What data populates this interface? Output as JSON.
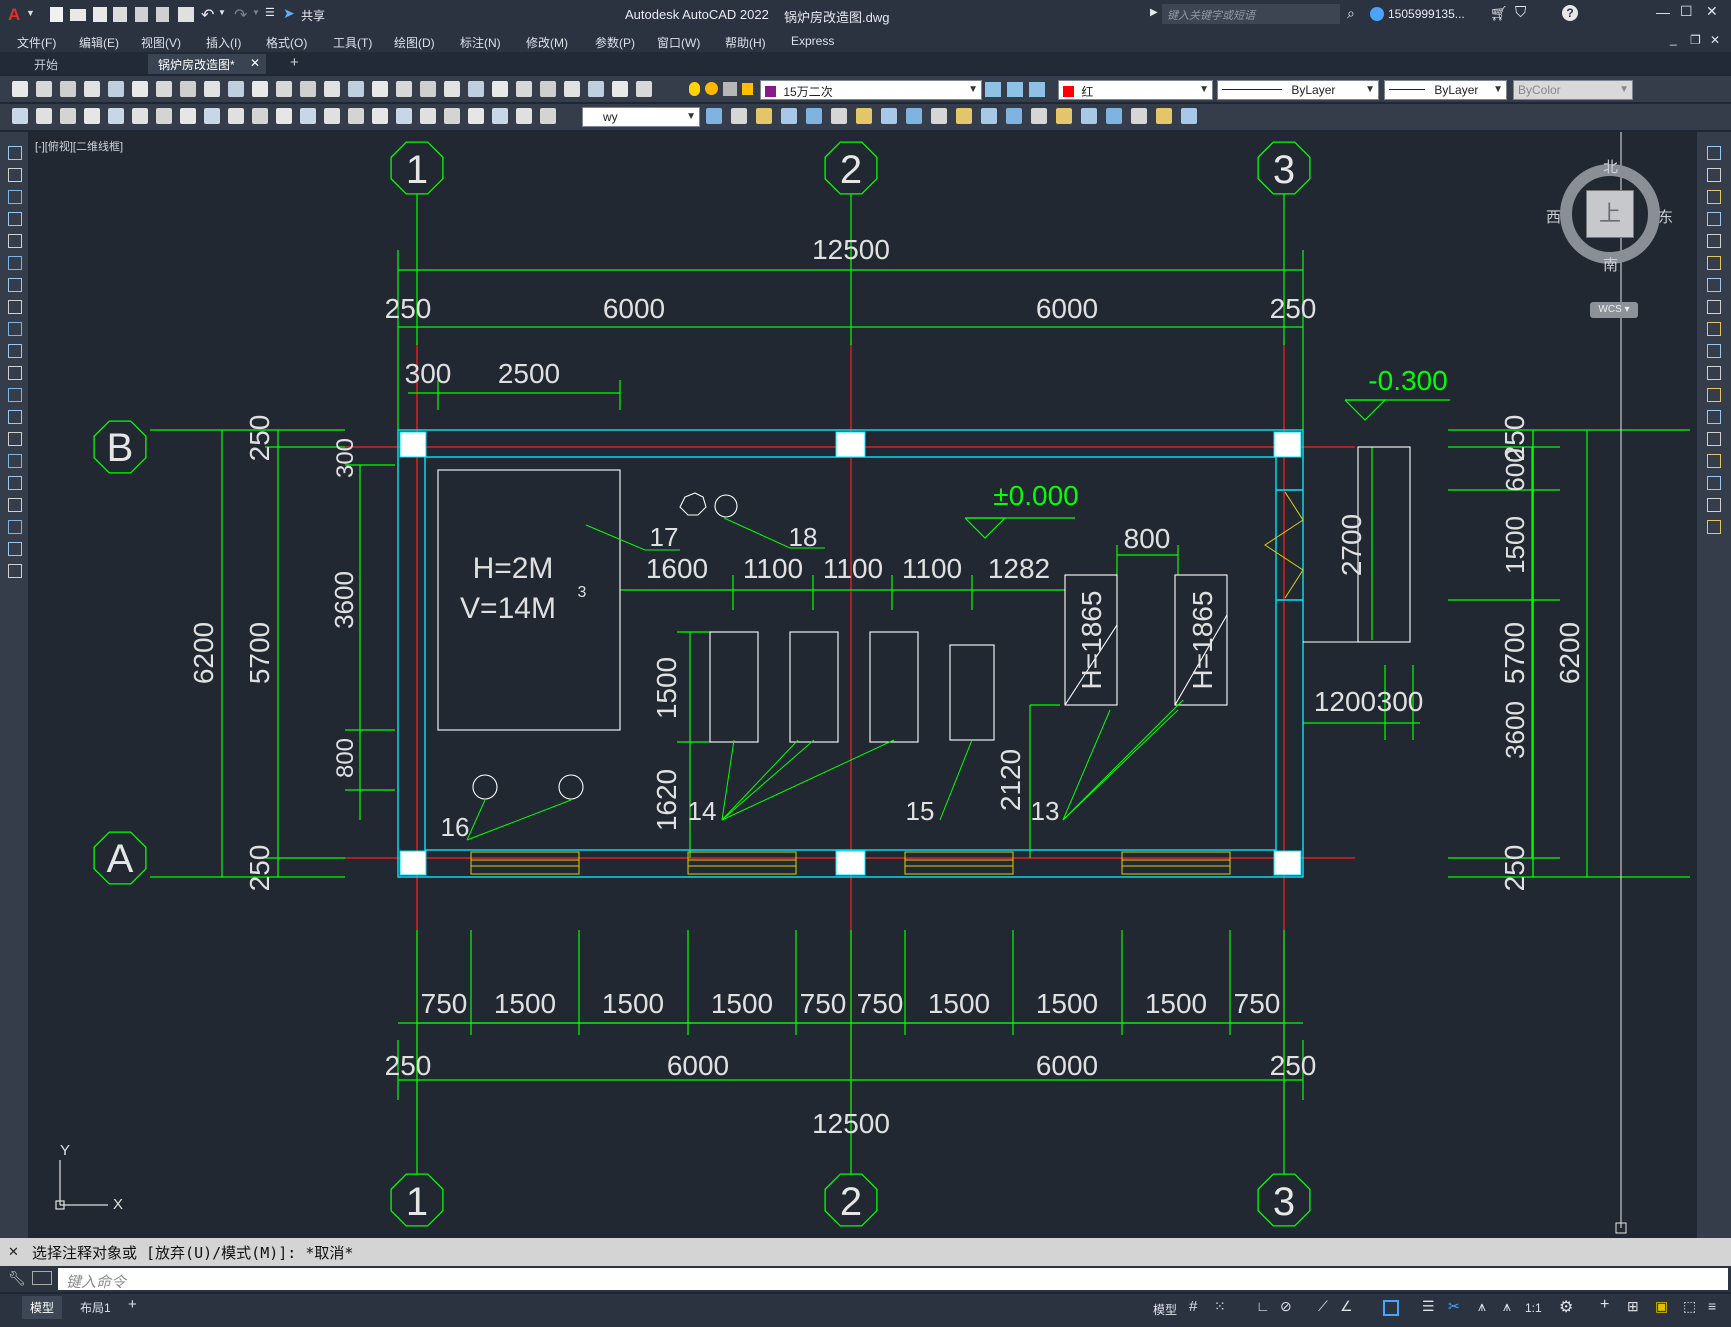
{
  "titlebar": {
    "app_title": "Autodesk AutoCAD 2022",
    "file_name": "锅炉房改造图.dwg",
    "share_label": "共享",
    "search_placeholder": "键入关键字或短语",
    "user_name": "1505999135...",
    "window_controls": [
      "minimize-icon",
      "maximize-icon",
      "close-icon"
    ]
  },
  "menu": {
    "items": [
      "文件(F)",
      "编辑(E)",
      "视图(V)",
      "插入(I)",
      "格式(O)",
      "工具(T)",
      "绘图(D)",
      "标注(N)",
      "修改(M)",
      "参数(P)",
      "窗口(W)",
      "帮助(H)",
      "Express"
    ]
  },
  "tabs": {
    "items": [
      {
        "label": "开始",
        "active": false
      },
      {
        "label": "锅炉房改造图*",
        "active": true
      }
    ],
    "new_tab": "+"
  },
  "toolbar": {
    "layer_name": "15万二次",
    "layer_color": "#8a1a8a",
    "color_name": "红",
    "color_swatch": "#ff0000",
    "linetype": "ByLayer",
    "lineweight": "ByLayer",
    "plotstyle": "ByColor",
    "dimstyle": "wy"
  },
  "viewport": {
    "label": "[-][俯视][二维线框]",
    "viewcube": {
      "north": "北",
      "south": "南",
      "east": "东",
      "west": "西",
      "face": "上",
      "wcs": "WCS"
    }
  },
  "drawing": {
    "colors": {
      "dim": "#00ff00",
      "wall": "#00e5ff",
      "axis": "#ff2020",
      "text": "#e0e0e0",
      "yellow": "#e0d000",
      "grid_bubble": "#00ff00"
    },
    "axes_top": [
      "1",
      "2",
      "3"
    ],
    "axes_left": [
      "B",
      "A"
    ],
    "top_dims": {
      "total": "12500",
      "segments": [
        "250",
        "6000",
        "6000",
        "250"
      ],
      "sub": [
        "300",
        "2500"
      ]
    },
    "elevations": [
      "-0.300",
      "±0.000"
    ],
    "left_dims": {
      "outer": "6200",
      "inner": "5700",
      "top": "250",
      "bottom": "250",
      "inner_segs": [
        "300",
        "3600",
        "800"
      ]
    },
    "tank_text": [
      "H=2M",
      "V=14M",
      "3"
    ],
    "equipment_labels": [
      "17",
      "18",
      "14",
      "15",
      "16",
      "13"
    ],
    "pump_dims": [
      "1600",
      "1100",
      "1100",
      "1100",
      "1282"
    ],
    "pump_vert_dims": [
      "1500",
      "1620",
      "2120"
    ],
    "boiler_dims": {
      "gap": "800",
      "height_a": "H=1865",
      "height_b": "H=1865"
    },
    "right_dims": {
      "opening": "2700",
      "d1": "1200",
      "d2": "300",
      "outer": "6200",
      "inner": "5700",
      "segs": [
        "250",
        "600",
        "1500",
        "3600",
        "250"
      ]
    },
    "bottom_dims": {
      "windows": [
        "750",
        "1500",
        "1500",
        "1500",
        "750",
        "750",
        "1500",
        "1500",
        "1500",
        "750"
      ],
      "mid": [
        "250",
        "6000",
        "6000",
        "250"
      ],
      "total": "12500"
    },
    "axes_bottom": [
      "1",
      "2",
      "3"
    ],
    "ucs": {
      "x": "X",
      "y": "Y"
    }
  },
  "command": {
    "history": "选择注释对象或 [放弃(U)/模式(M)]: *取消*",
    "input_placeholder": "键入命令"
  },
  "status": {
    "layout_tabs": [
      "模型",
      "布局1"
    ],
    "add_layout": "+",
    "model_label": "模型",
    "scale": "1:1"
  }
}
